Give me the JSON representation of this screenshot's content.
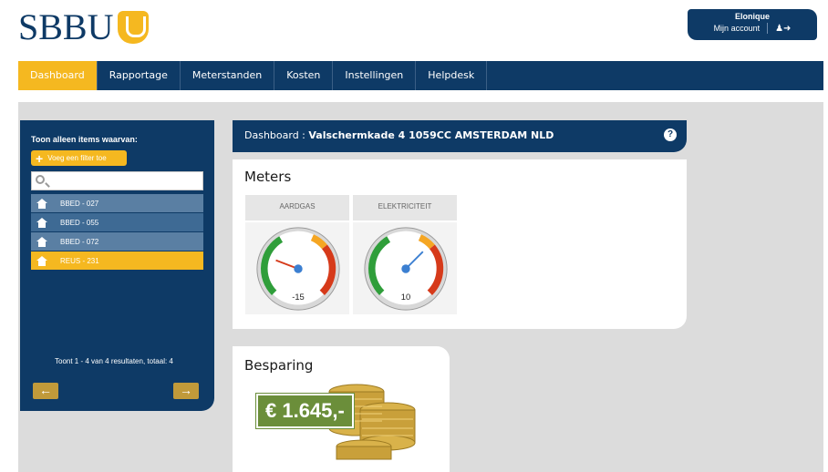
{
  "brand": {
    "logo_text": "SBBU"
  },
  "account": {
    "username": "Elonique",
    "link_label": "Mijn account",
    "logout_icon": "user-logout-icon"
  },
  "nav": {
    "tabs": [
      {
        "label": "Dashboard",
        "active": true
      },
      {
        "label": "Rapportage"
      },
      {
        "label": "Meterstanden"
      },
      {
        "label": "Kosten"
      },
      {
        "label": "Instellingen"
      },
      {
        "label": "Helpdesk"
      }
    ]
  },
  "sidebar": {
    "title": "Toon alleen items waarvan:",
    "add_filter_label": "Voeg een filter toe",
    "search_placeholder": "",
    "items": [
      {
        "label": "BBED - 027"
      },
      {
        "label": "BBED - 055"
      },
      {
        "label": "BBED - 072"
      },
      {
        "label": "REUS - 231",
        "active": true
      }
    ],
    "result_count": "Toont 1 - 4 van 4 resultaten, totaal: 4",
    "prev_icon": "arrow-left-icon",
    "next_icon": "arrow-right-icon"
  },
  "dashboard": {
    "prefix": "Dashboard : ",
    "address": "Valschermkade 4 1059CC AMSTERDAM NLD",
    "help_icon": "help-icon"
  },
  "meters": {
    "title": "Meters",
    "gauges": [
      {
        "label": "AARDGAS",
        "value": "-15"
      },
      {
        "label": "ELEKTRICITEIT",
        "value": "10"
      }
    ]
  },
  "savings": {
    "title": "Besparing",
    "amount": "€ 1.645,-"
  },
  "colors": {
    "navy": "#0e3a66",
    "gold": "#f5b820",
    "green_badge": "#6b8e3a"
  }
}
